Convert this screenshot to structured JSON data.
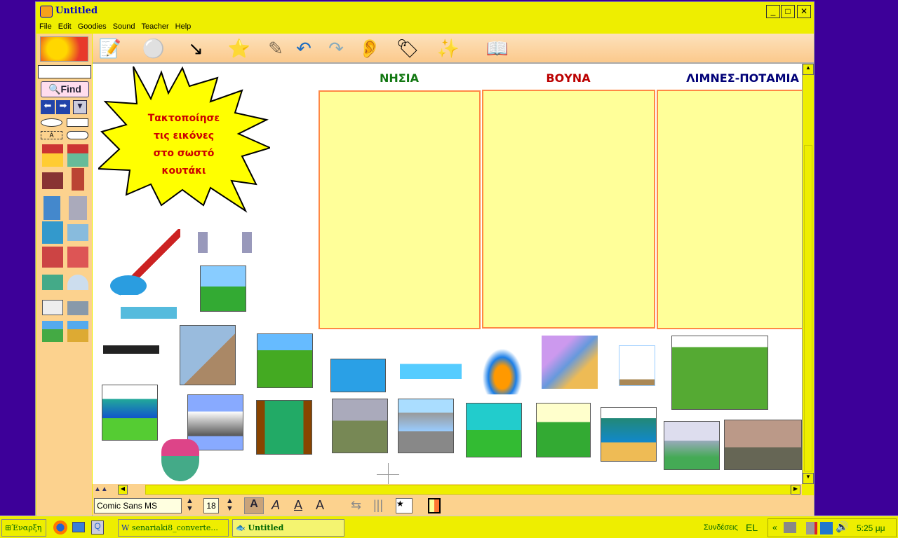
{
  "window": {
    "title": "Untitled",
    "controls": [
      "minimize",
      "maximize",
      "close"
    ]
  },
  "menu": [
    "File",
    "Edit",
    "Goodies",
    "Sound",
    "Teacher",
    "Help"
  ],
  "palette": {
    "search_value": "",
    "find_label": "Find"
  },
  "toolbar": [
    "add-text-icon",
    "add-node-icon",
    "link-icon",
    "stars-box-icon",
    "eraser-icon",
    "undo-icon",
    "redo-icon",
    "listen-icon",
    "name-tag-icon",
    "magic-wand-icon",
    "book-magnifier-icon"
  ],
  "canvas": {
    "burst_text": [
      "Τακτοποίησε",
      "τις εικόνες",
      "στο σωστό",
      "κουτάκι"
    ],
    "columns": [
      {
        "title": "ΝΗΣΙΑ",
        "color": "#117711"
      },
      {
        "title": "ΒΟΥΝΑ",
        "color": "#bb0000"
      },
      {
        "title": "ΛΙΜΝΕΣ-ΠΟΤΑΜΙΑ",
        "color": "#000077"
      }
    ],
    "colors": {
      "box_fill": "#ffff99",
      "box_border": "#ff8844",
      "burst_fill": "#ffff00",
      "burst_text": "#cc0000"
    }
  },
  "format": {
    "font": "Comic Sans MS",
    "size": "18"
  },
  "taskbar": {
    "start": "Έναρξη",
    "tasks": [
      "senariaki8_converte...",
      "Untitled"
    ],
    "links": "Συνδέσεις",
    "lang": "EL",
    "time": "5:25 μμ"
  },
  "colors": {
    "desktop": "#3d0099",
    "window": "#eeee00",
    "palette": "#fcd28e"
  }
}
